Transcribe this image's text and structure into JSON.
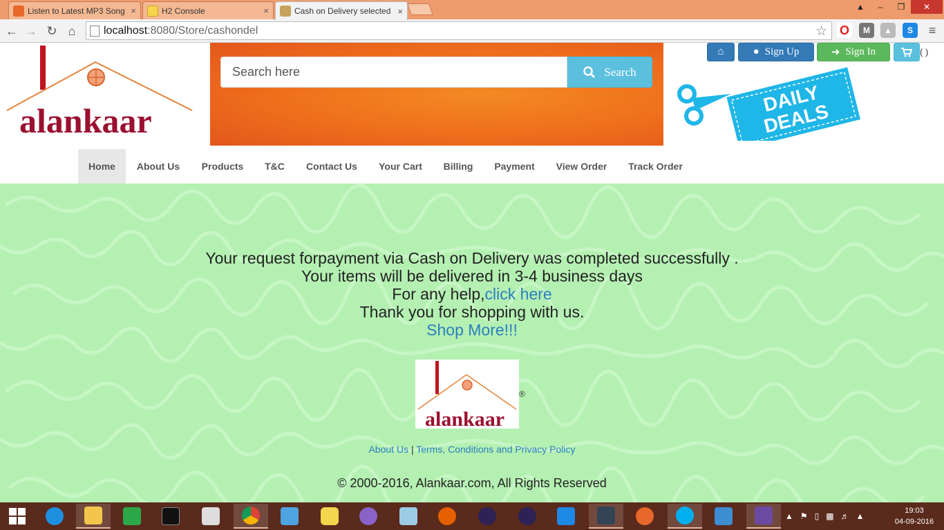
{
  "browser": {
    "tabs": [
      {
        "title": "Listen to Latest MP3 Song",
        "close": "×",
        "favicon_color": "#e8672b"
      },
      {
        "title": "H2 Console",
        "close": "×",
        "favicon_color": "#f5d44e"
      },
      {
        "title": "Cash on Delivery selected",
        "close": "×",
        "favicon_color": "#c8a25b"
      }
    ],
    "url_host": "localhost",
    "url_path": ":8080/Store/cashondel",
    "window_controls": [
      "▲",
      "–",
      "❐",
      "✕"
    ]
  },
  "site": {
    "brand": "alankaar",
    "search": {
      "placeholder": "Search here",
      "button_label": "Search"
    },
    "top_buttons": {
      "signup_label": "Sign Up",
      "signin_label": "Sign In",
      "cart_count": "( )"
    },
    "deals_label_line1": "DAILY",
    "deals_label_line2": "DEALS",
    "nav": [
      "Home",
      "About Us",
      "Products",
      "T&C",
      "Contact Us",
      "Your Cart",
      "Billing",
      "Payment",
      "View Order",
      "Track Order"
    ],
    "message": {
      "line1": "Your request forpayment via Cash on Delivery was completed successfully .",
      "line2": "Your items will be delivered in 3-4 business days",
      "line3_prefix": "For any help,",
      "line3_link": "click here",
      "line4": "Thank you for shopping with us.",
      "shop_more": "Shop More!!!"
    },
    "footer": {
      "registered": "®",
      "about_link": "About Us",
      "separator": "|",
      "terms_link": "Terms, Conditions and Privacy Policy",
      "copyright": "© 2000-2016, Alankaar.com, All Rights Reserved"
    }
  },
  "taskbar": {
    "time": "19:03",
    "date": "04-09-2016"
  },
  "colors": {
    "content_bg": "#b4f0b2",
    "brand_maroon": "#9b1030",
    "link": "#2c7fbf",
    "taskbar": "#5a2a1c"
  }
}
